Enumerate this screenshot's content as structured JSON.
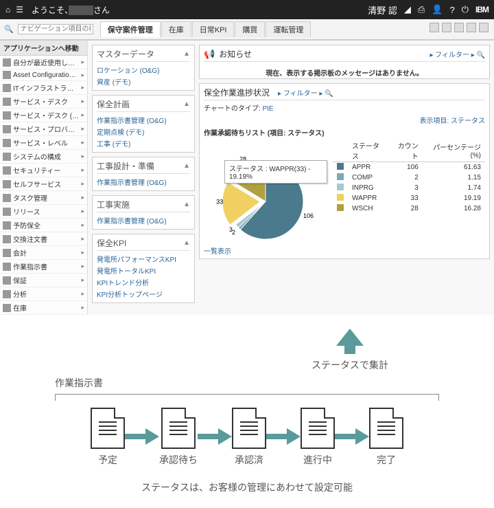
{
  "topbar": {
    "welcome_prefix": "ようこそ、",
    "welcome_suffix": "さん",
    "username": "清野 認",
    "ibm": "IBM"
  },
  "search": {
    "placeholder": "ナビゲーション項目の検索"
  },
  "tabs": [
    "保守案件管理",
    "在庫",
    "日常KPI",
    "購買",
    "運転管理"
  ],
  "nav_header": "アプリケーションへ移動",
  "nav": [
    {
      "label": "自分が最近使用したアプ…"
    },
    {
      "label": "Asset Configuration Ma…"
    },
    {
      "label": "ITインフラストラクチャー"
    },
    {
      "label": "サービス・デスク"
    },
    {
      "label": "サービス・デスク (O&G)"
    },
    {
      "label": "サービス・プロバイダー"
    },
    {
      "label": "サービス・レベル"
    },
    {
      "label": "システムの構成"
    },
    {
      "label": "セキュリティー"
    },
    {
      "label": "セルフサービス"
    },
    {
      "label": "タスク管理"
    },
    {
      "label": "リリース"
    },
    {
      "label": "予防保全"
    },
    {
      "label": "交換注文書"
    },
    {
      "label": "会計"
    },
    {
      "label": "作業指示書"
    },
    {
      "label": "保証"
    },
    {
      "label": "分析"
    },
    {
      "label": "在庫"
    }
  ],
  "panels": {
    "master": {
      "title": "マスターデータ",
      "links": [
        "ロケーション (O&G)",
        "資産 (デモ)"
      ]
    },
    "plan": {
      "title": "保全計画",
      "links": [
        "作業指示書管理 (O&G)",
        "定期点検 (デモ)",
        "工事 (デモ)"
      ]
    },
    "design": {
      "title": "工事設計・準備",
      "links": [
        "作業指示書管理 (O&G)"
      ]
    },
    "exec": {
      "title": "工事実施",
      "links": [
        "作業指示書管理 (O&G)"
      ]
    },
    "kpi": {
      "title": "保全KPI",
      "links": [
        "発電所パフォーマンスKPI",
        "発電所トータルKPI",
        "KPIトレンド分析",
        "KPI分析トップページ"
      ]
    }
  },
  "notice": {
    "title": "お知らせ",
    "filter": "フィルター",
    "body": "現在、表示する掲示板のメッセージはありません。"
  },
  "chart": {
    "title": "保全作業進捗状況",
    "filter": "フィルター",
    "meta_type_label": "チャートのタイプ:",
    "meta_type": "PIE",
    "meta_list": "作業承認待ちリスト (項目: ステータス)",
    "display_item_label": "表示項目:",
    "display_item": "ステータス",
    "tooltip": "ステータス : WAPPR(33) - 19.19%",
    "headers": [
      "ステータス",
      "カウント",
      "パーセンテージ (%)"
    ],
    "listlink": "一覧表示"
  },
  "chart_data": {
    "type": "pie",
    "title": "保全作業進捗状況",
    "series": [
      {
        "name": "APPR",
        "count": 106,
        "percentage": 61.63,
        "color": "#4a7a8c"
      },
      {
        "name": "COMP",
        "count": 2,
        "percentage": 1.15,
        "color": "#7aa8b8"
      },
      {
        "name": "INPRG",
        "count": 3,
        "percentage": 1.74,
        "color": "#a8c8d0"
      },
      {
        "name": "WAPPR",
        "count": 33,
        "percentage": 19.19,
        "color": "#f0d060"
      },
      {
        "name": "WSCH",
        "count": 28,
        "percentage": 16.28,
        "color": "#b0a040"
      }
    ]
  },
  "diagram": {
    "arrow_label": "ステータスで集計",
    "bracket_label": "作業指示書",
    "steps": [
      "予定",
      "承認待ち",
      "承認済",
      "進行中",
      "完了"
    ],
    "footnote": "ステータスは、お客様の管理にあわせて設定可能"
  }
}
